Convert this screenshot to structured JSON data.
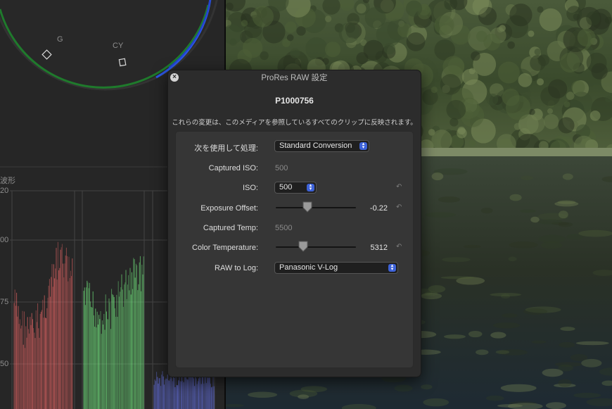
{
  "colors": {
    "accent": "#3d62d8",
    "panel": "#262626",
    "dialog_bg": "#2c2c2c",
    "scope_red": "#ff6e6e",
    "scope_green": "#7dff8a",
    "scope_blue": "#6f7dff"
  },
  "color_wheel": {
    "labels": [
      "G",
      "CY"
    ]
  },
  "waveform": {
    "title": "波形",
    "scale": [
      "20",
      "00",
      "75",
      "50"
    ]
  },
  "dialog": {
    "title": "ProRes RAW 設定",
    "media_name": "P1000756",
    "notice": "これらの変更は、このメディアを参照しているすべてのクリップに反映されます。",
    "process_label": "次を使用して処理:",
    "process_value": "Standard Conversion",
    "captured_iso_label": "Captured ISO:",
    "captured_iso_value": "500",
    "iso_label": "ISO:",
    "iso_value": "500",
    "exposure_label": "Exposure Offset:",
    "exposure_value": "-0.22",
    "captured_temp_label": "Captured Temp:",
    "captured_temp_value": "5500",
    "color_temp_label": "Color Temperature:",
    "color_temp_value": "5312",
    "raw_to_log_label": "RAW to Log:",
    "raw_to_log_value": "Panasonic V-Log"
  }
}
